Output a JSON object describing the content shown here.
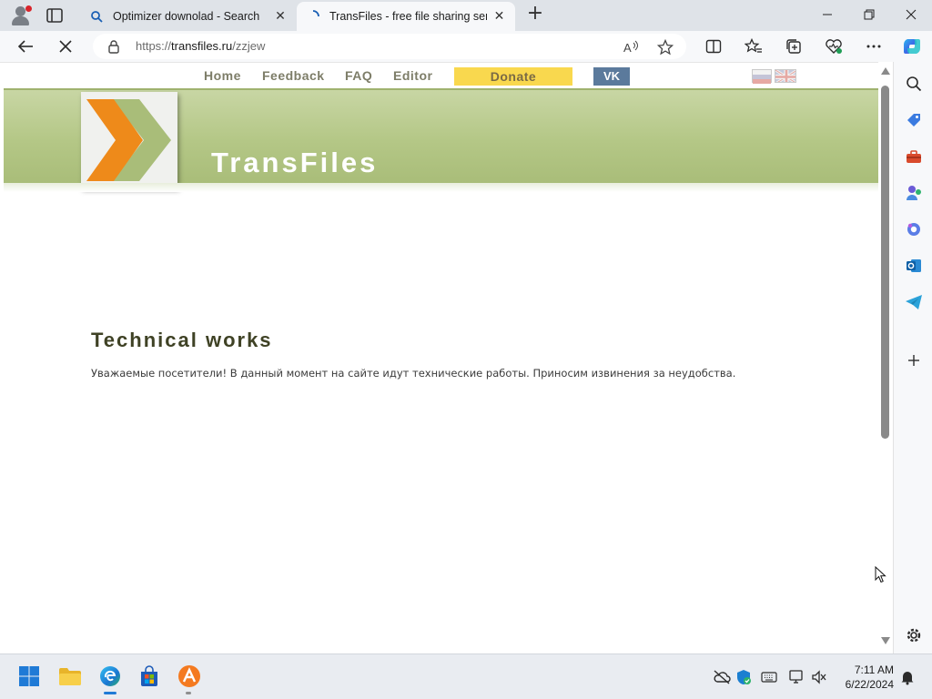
{
  "browser": {
    "tabs": [
      {
        "title": "Optimizer downolad - Search",
        "active": false
      },
      {
        "title": "TransFiles - free file sharing servi",
        "active": true
      }
    ],
    "address_bar": {
      "url_prefix": "https://",
      "url_host": "transfiles.ru",
      "url_path": "/zzjew"
    }
  },
  "site": {
    "brand": "TransFiles",
    "nav": {
      "home": "Home",
      "feedback": "Feedback",
      "faq": "FAQ",
      "editor": "Editor",
      "donate": "Donate",
      "vk": "VK"
    },
    "languages": [
      "ru-flag-icon",
      "uk-flag-icon"
    ],
    "colors": {
      "header_green": "#b4c786",
      "donate_yellow": "#f9d84e",
      "vk_blue": "#5b7a9c",
      "logo_orange": "#ee8a1a"
    }
  },
  "content": {
    "title": "Technical works",
    "message": "Уважаемые посетители! В данный момент на сайте идут технические работы. Приносим извинения за неудобства."
  },
  "sidebar_icons": [
    "search-icon",
    "tag-icon",
    "toolbox-icon",
    "games-icon",
    "copilot-icon",
    "outlook-icon",
    "telegram-icon",
    "add-icon",
    "settings-icon"
  ],
  "taskbar": {
    "apps": [
      "start-icon",
      "file-explorer-icon",
      "edge-icon",
      "store-icon",
      "avast-icon"
    ],
    "clock": {
      "time": "7:11 AM",
      "date": "6/22/2024"
    }
  }
}
